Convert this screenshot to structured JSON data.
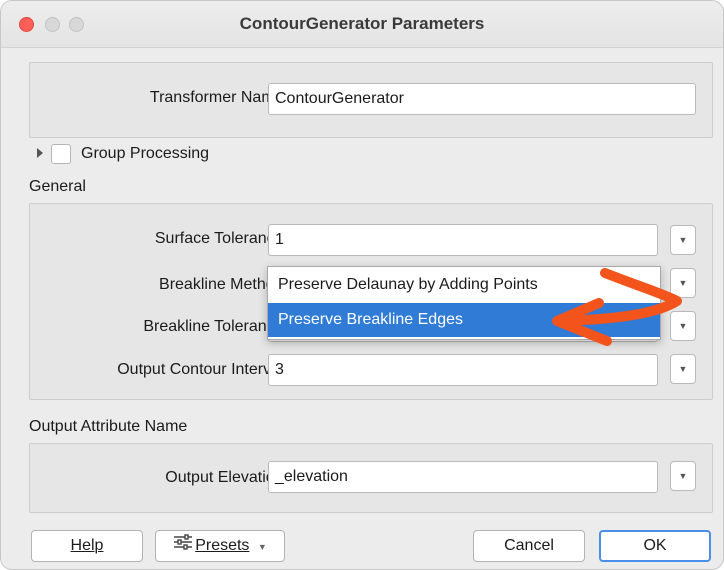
{
  "window": {
    "title": "ContourGenerator Parameters"
  },
  "transformer": {
    "label": "Transformer Name:",
    "value": "ContourGenerator"
  },
  "group_processing": {
    "label": "Group Processing",
    "checked": false
  },
  "general": {
    "heading": "General",
    "surface_tolerance": {
      "label": "Surface Tolerance:",
      "value": "1"
    },
    "breakline_method": {
      "label": "Breakline Method:",
      "value": "Preserve Delaunay by Adding Points"
    },
    "breakline_tolerance": {
      "label": "Breakline Tolerance:"
    },
    "output_contour_interval": {
      "label": "Output Contour Interval:",
      "value": "3"
    }
  },
  "dropdown_options": [
    "Preserve Delaunay by Adding Points",
    "Preserve Breakline Edges"
  ],
  "attributes": {
    "heading": "Output Attribute Name",
    "output_elevation": {
      "label": "Output Elevation:",
      "value": "_elevation"
    }
  },
  "buttons": {
    "help": "Help",
    "presets": "Presets",
    "cancel": "Cancel",
    "ok": "OK"
  },
  "colors": {
    "highlight": "#2f7bd6",
    "annotation_arrow": "#f2541b",
    "close": "#ff5f57"
  }
}
